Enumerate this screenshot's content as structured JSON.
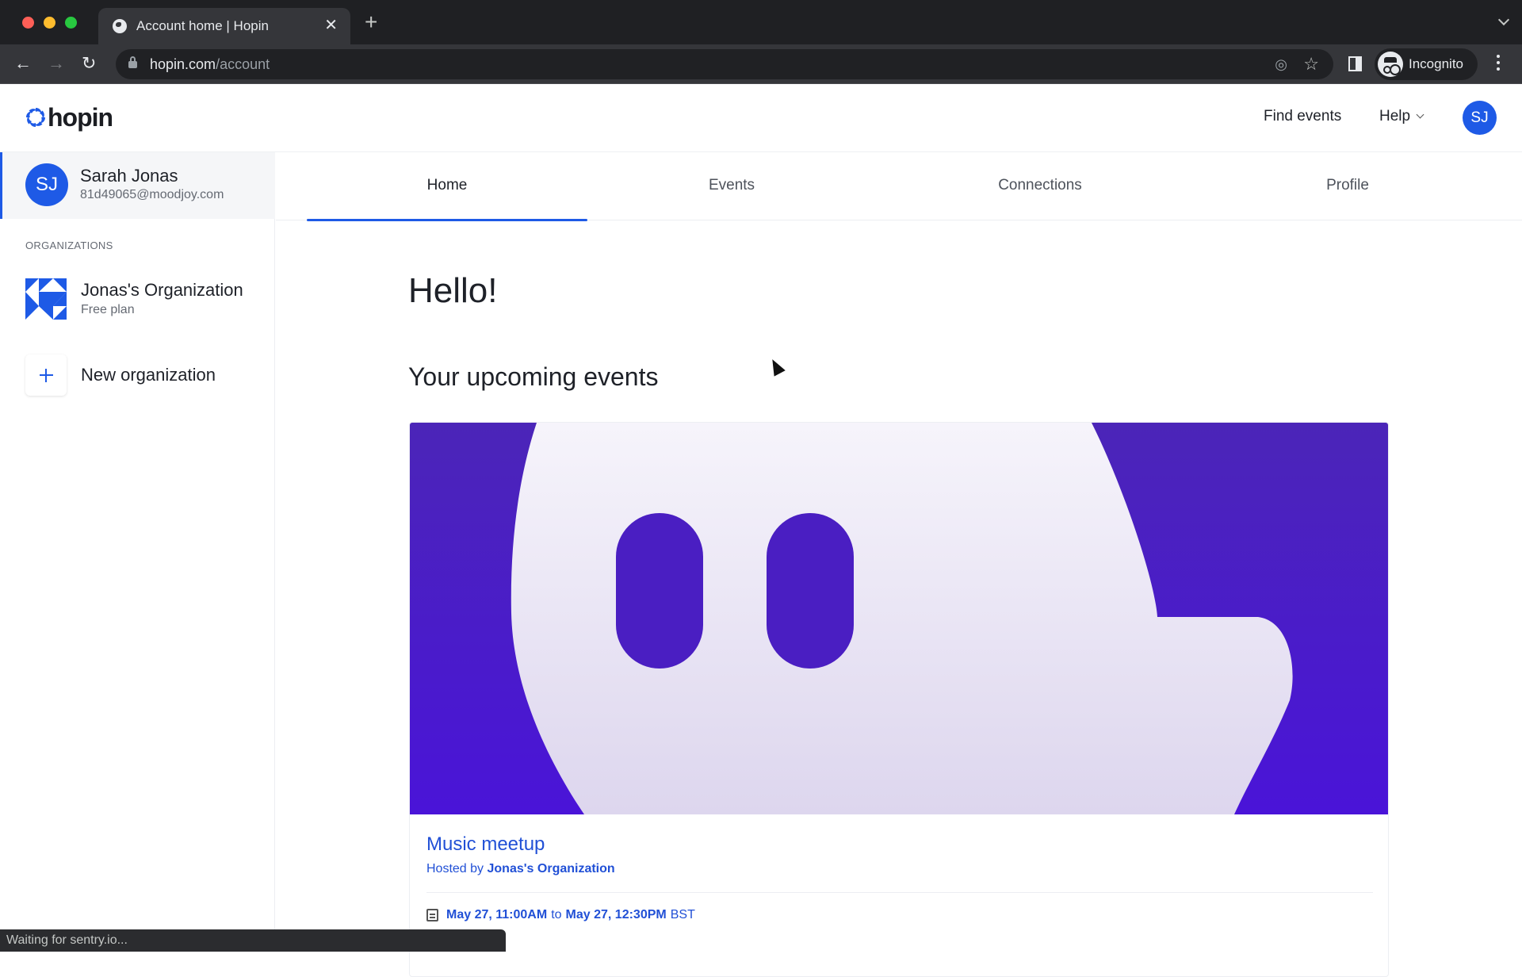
{
  "browser": {
    "tab_title": "Account home | Hopin",
    "url_host": "hopin.com",
    "url_path": "/account",
    "profile_label": "Incognito",
    "icons": [
      "globe-icon",
      "close-icon",
      "plus-icon",
      "back-arrow-icon",
      "forward-arrow-icon",
      "reload-icon",
      "lock-icon",
      "eye-off-icon",
      "star-icon",
      "side-panel-icon",
      "incognito-icon",
      "kebab-menu-icon",
      "chevron-down-icon"
    ]
  },
  "header": {
    "logo_text": "hopin",
    "find_events": "Find events",
    "help": "Help",
    "avatar_initials": "SJ"
  },
  "sidebar": {
    "user": {
      "initials": "SJ",
      "name": "Sarah Jonas",
      "email": "81d49065@moodjoy.com"
    },
    "organizations_heading": "ORGANIZATIONS",
    "organizations": [
      {
        "name": "Jonas's Organization",
        "plan": "Free plan"
      }
    ],
    "new_org_label": "New organization"
  },
  "tabs": [
    {
      "label": "Home",
      "active": true
    },
    {
      "label": "Events",
      "active": false
    },
    {
      "label": "Connections",
      "active": false
    },
    {
      "label": "Profile",
      "active": false
    }
  ],
  "main": {
    "greeting": "Hello!",
    "upcoming_heading": "Your upcoming events",
    "events": [
      {
        "title": "Music meetup",
        "hosted_by_prefix": "Hosted by",
        "host": "Jonas's Organization",
        "start": "May 27, 11:00AM",
        "connector": "to",
        "end": "May 27, 12:30PM",
        "timezone": "BST"
      }
    ]
  },
  "status_bar": "Waiting for sentry.io...",
  "colors": {
    "brand_blue": "#1e5ae6",
    "link_blue": "#2150d6",
    "banner_purple": "#4a19d6"
  }
}
